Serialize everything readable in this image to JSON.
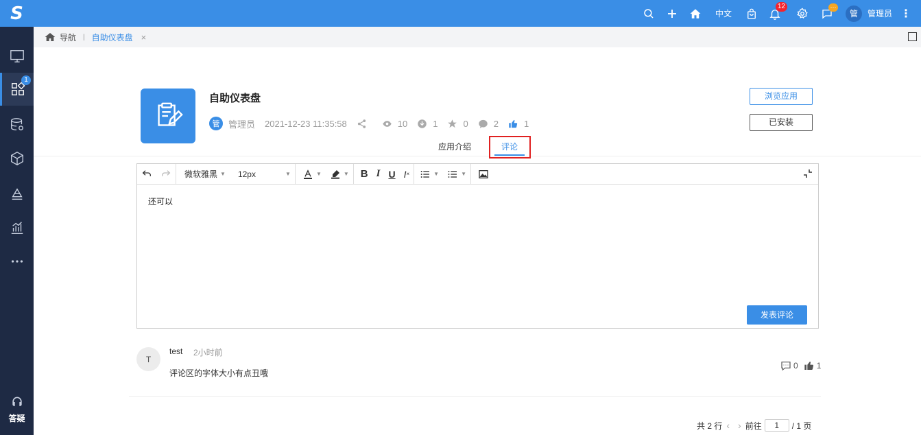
{
  "topbar": {
    "language": "中文",
    "notification_count": "12",
    "chat_badge": "···",
    "user_avatar": "管",
    "user_name": "管理员"
  },
  "sidebar": {
    "logo": "S",
    "apps_badge": "1",
    "help_label": "答疑"
  },
  "breadcrumb": {
    "home_label": "导航",
    "tab_label": "自助仪表盘",
    "close": "×"
  },
  "app": {
    "title": "自助仪表盘",
    "author_avatar": "管",
    "author": "管理员",
    "date": "2021-12-23 11:35:58",
    "views": "10",
    "downloads": "1",
    "favorites": "0",
    "comments": "2",
    "likes": "1",
    "browse_button": "浏览应用",
    "installed_button": "已安装"
  },
  "tabs": {
    "intro": "应用介绍",
    "comment": "评论"
  },
  "editor": {
    "font_family": "微软雅黑",
    "font_size": "12px",
    "content": "还可以",
    "post_button": "发表评论"
  },
  "comment": {
    "avatar": "T",
    "user": "test",
    "time": "2小时前",
    "text": "评论区的字体大小有点丑哦",
    "reply_count": "0",
    "like_count": "1"
  },
  "pagination": {
    "total": "共 2 行",
    "goto": "前往",
    "page": "1",
    "of_pages": "/ 1 页"
  },
  "colors": {
    "primary": "#3a8ee6",
    "sidebar": "#1e2a44",
    "highlight": "#e02020"
  }
}
